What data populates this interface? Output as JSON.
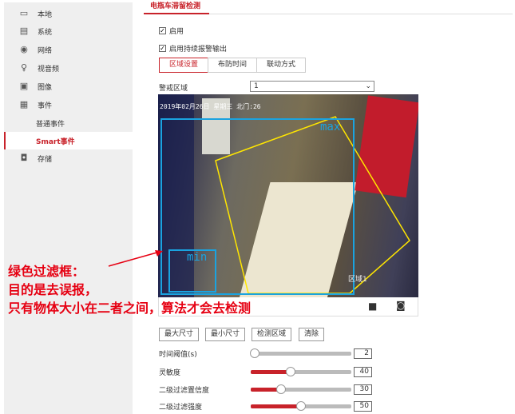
{
  "sidebar": {
    "items": [
      {
        "label": "本地",
        "icon": "monitor-icon"
      },
      {
        "label": "系统",
        "icon": "window-icon"
      },
      {
        "label": "网络",
        "icon": "globe-icon"
      },
      {
        "label": "视音频",
        "icon": "microphone-icon"
      },
      {
        "label": "图像",
        "icon": "image-icon"
      },
      {
        "label": "事件",
        "icon": "calendar-icon"
      },
      {
        "label": "普通事件"
      },
      {
        "label": "Smart事件"
      },
      {
        "label": "存储",
        "icon": "floppy-icon"
      }
    ]
  },
  "header": {
    "tab": "电瓶车滞留检测"
  },
  "options": {
    "enable": "启用",
    "continuous": "启用持续报警输出"
  },
  "steps": [
    "区域设置",
    "布防时间",
    "联动方式"
  ],
  "zone": {
    "label": "警戒区域",
    "value": "1"
  },
  "video": {
    "osd": "2019年02月26日 星期三 北门:26",
    "max_label": "max",
    "min_label": "min",
    "region_label": "区域1"
  },
  "buttons": {
    "max": "最大尺寸",
    "min": "最小尺寸",
    "detect": "检测区域",
    "clear": "清除"
  },
  "sliders": [
    {
      "label": "时间阈值(s)",
      "value": "2",
      "fraction": 0
    },
    {
      "label": "灵敏度",
      "value": "40",
      "fraction": 0.4
    },
    {
      "label": "二级过滤置信度",
      "value": "30",
      "fraction": 0.3
    },
    {
      "label": "二级过滤强度",
      "value": "50",
      "fraction": 0.5
    }
  ],
  "annotation": [
    "绿色过滤框：",
    "目的是去误报，",
    "只有物体大小在二者之间，算法才会去检测"
  ],
  "colors": {
    "accent": "#c8222a",
    "max_box": "#1aa3e0",
    "region": "#ffe600",
    "annotation": "#e60012"
  }
}
